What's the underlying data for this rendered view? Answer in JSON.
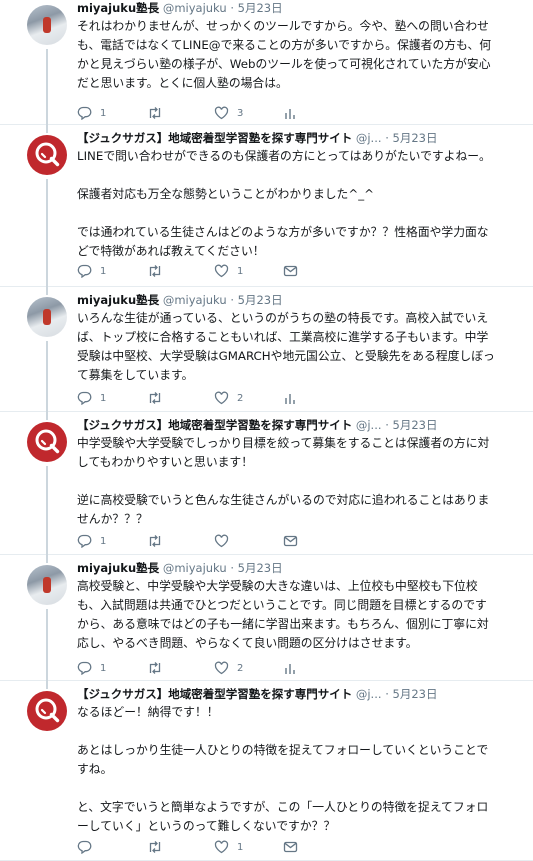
{
  "tweets": [
    {
      "type": "user",
      "name": "miyajuku塾長",
      "handle": "@miyajuku",
      "sep": "·",
      "date": "5月23日",
      "lines": [
        "それはわかりませんが、せっかくのツールですから。今や、塾への問い合わせ",
        "も、電話ではなくてLINE@で来ることの方が多いですから。保護者の方も、何",
        "かと見えづらい塾の様子が、Webのツールを使って可視化されていた方が安心",
        "だと思います。とくに個人塾の場合は。"
      ],
      "stats": {
        "reply": "1",
        "retweet": "",
        "like": "3"
      }
    },
    {
      "type": "brand",
      "name": "【ジュクサガス】地域密着型学習塾を探す専門サイト",
      "handle": "@j...",
      "sep": "·",
      "date": "5月23日",
      "lines": [
        "LINEで問い合わせができるのも保護者の方にとってはありがたいですよねー。",
        "",
        "保護者対応も万全な態勢ということがわかりました^_^",
        "",
        "では通われている生徒さんはどのような方が多いですか？？性格面や学力面な",
        "どで特徴があれば教えてください！"
      ],
      "stats": {
        "reply": "1",
        "retweet": "",
        "like": "1"
      }
    },
    {
      "type": "user",
      "name": "miyajuku塾長",
      "handle": "@miyajuku",
      "sep": "·",
      "date": "5月23日",
      "lines": [
        "いろんな生徒が通っている、というのがうちの塾の特長です。高校入試でいえ",
        "ば、トップ校に合格することもいれば、工業高校に進学する子もいます。中学",
        "受験は中堅校、大学受験はGMARCHや地元国公立、と受験先をある程度しぼっ",
        "て募集をしています。"
      ],
      "stats": {
        "reply": "1",
        "retweet": "",
        "like": "2"
      }
    },
    {
      "type": "brand",
      "name": "【ジュクサガス】地域密着型学習塾を探す専門サイト",
      "handle": "@j...",
      "sep": "·",
      "date": "5月23日",
      "lines": [
        "中学受験や大学受験でしっかり目標を絞って募集をすることは保護者の方に対",
        "してもわかりやすいと思います！",
        "",
        "逆に高校受験でいうと色んな生徒さんがいるので対応に追われることはありま",
        "せんか？？？"
      ],
      "stats": {
        "reply": "1",
        "retweet": "",
        "like": ""
      }
    },
    {
      "type": "user",
      "name": "miyajuku塾長",
      "handle": "@miyajuku",
      "sep": "·",
      "date": "5月23日",
      "lines": [
        "高校受験と、中学受験や大学受験の大きな違いは、上位校も中堅校も下位校",
        "も、入試問題は共通でひとつだということです。同じ問題を目標とするのです",
        "から、ある意味ではどの子も一緒に学習出来ます。もちろん、個別に丁寧に対",
        "応し、やるべき問題、やらなくて良い問題の区分けはさせます。"
      ],
      "stats": {
        "reply": "1",
        "retweet": "",
        "like": "2"
      }
    },
    {
      "type": "brand",
      "name": "【ジュクサガス】地域密着型学習塾を探す専門サイト",
      "handle": "@j...",
      "sep": "·",
      "date": "5月23日",
      "lines": [
        "なるほどー！納得です！！",
        "",
        "あとはしっかり生徒一人ひとりの特徴を捉えてフォローしていくということで",
        "すね。",
        "",
        "と、文字でいうと簡単なようですが、この「一人ひとりの特徴を捉えてフォロ",
        "ーしていく」というのって難しくないですか？？"
      ],
      "stats": {
        "reply": "",
        "retweet": "",
        "like": "1"
      }
    }
  ]
}
